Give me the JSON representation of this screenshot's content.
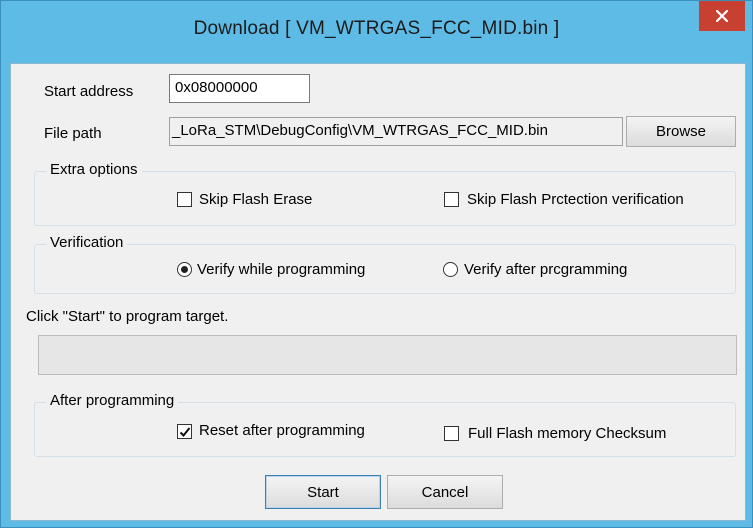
{
  "window": {
    "title": "Download [ VM_WTRGAS_FCC_MID.bin ]",
    "close_icon": "close-icon"
  },
  "fields": {
    "start_address_label": "Start address",
    "start_address_value": "0x08000000",
    "file_path_label": "File path",
    "file_path_value": "_LoRa_STM\\DebugConfig\\VM_WTRGAS_FCC_MID.bin",
    "browse_label": "Browse"
  },
  "extra_options": {
    "title": "Extra options",
    "skip_flash_erase": {
      "label": "Skip Flash Erase",
      "checked": false
    },
    "skip_flash_protection": {
      "label": "Skip Flash Prctection verification",
      "checked": false
    }
  },
  "verification": {
    "title": "Verification",
    "verify_while": {
      "label": "Verify while programming",
      "selected": true
    },
    "verify_after": {
      "label": "Verify after prcgramming",
      "selected": false
    }
  },
  "status": {
    "message": "Click \"Start\" to program target.",
    "progress": 0
  },
  "after_programming": {
    "title": "After programming",
    "reset_after": {
      "label": "Reset after programming",
      "checked": true
    },
    "full_checksum": {
      "label": "Full Flash memory Checksum",
      "checked": false
    }
  },
  "buttons": {
    "start": "Start",
    "cancel": "Cancel"
  },
  "colors": {
    "titlebar": "#5ebbe6",
    "close_button": "#c84031",
    "client_bg": "#f0f0f0"
  }
}
